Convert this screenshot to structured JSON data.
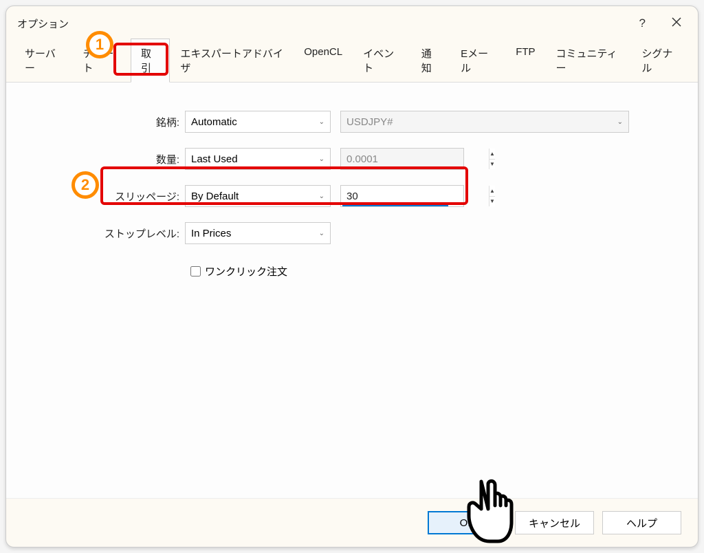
{
  "dialog": {
    "title": "オプション"
  },
  "tabs": {
    "server": "サーバー",
    "chart": "チャート",
    "trade": "取引",
    "expert": "エキスパートアドバイザ",
    "opencl": "OpenCL",
    "event": "イベント",
    "notification": "通知",
    "email": "Eメール",
    "ftp": "FTP",
    "community": "コミュニティー",
    "signal": "シグナル"
  },
  "form": {
    "symbol_label": "銘柄:",
    "symbol_mode": "Automatic",
    "symbol_value": "USDJPY#",
    "volume_label": "数量:",
    "volume_mode": "Last Used",
    "volume_value": "0.0001",
    "slippage_label": "スリッページ:",
    "slippage_mode": "By Default",
    "slippage_value": "30",
    "stoplevel_label": "ストップレベル:",
    "stoplevel_mode": "In Prices",
    "oneclick_label": "ワンクリック注文"
  },
  "footer": {
    "ok": "OK",
    "cancel": "キャンセル",
    "help": "ヘルプ"
  },
  "callouts": {
    "one": "1",
    "two": "2"
  }
}
